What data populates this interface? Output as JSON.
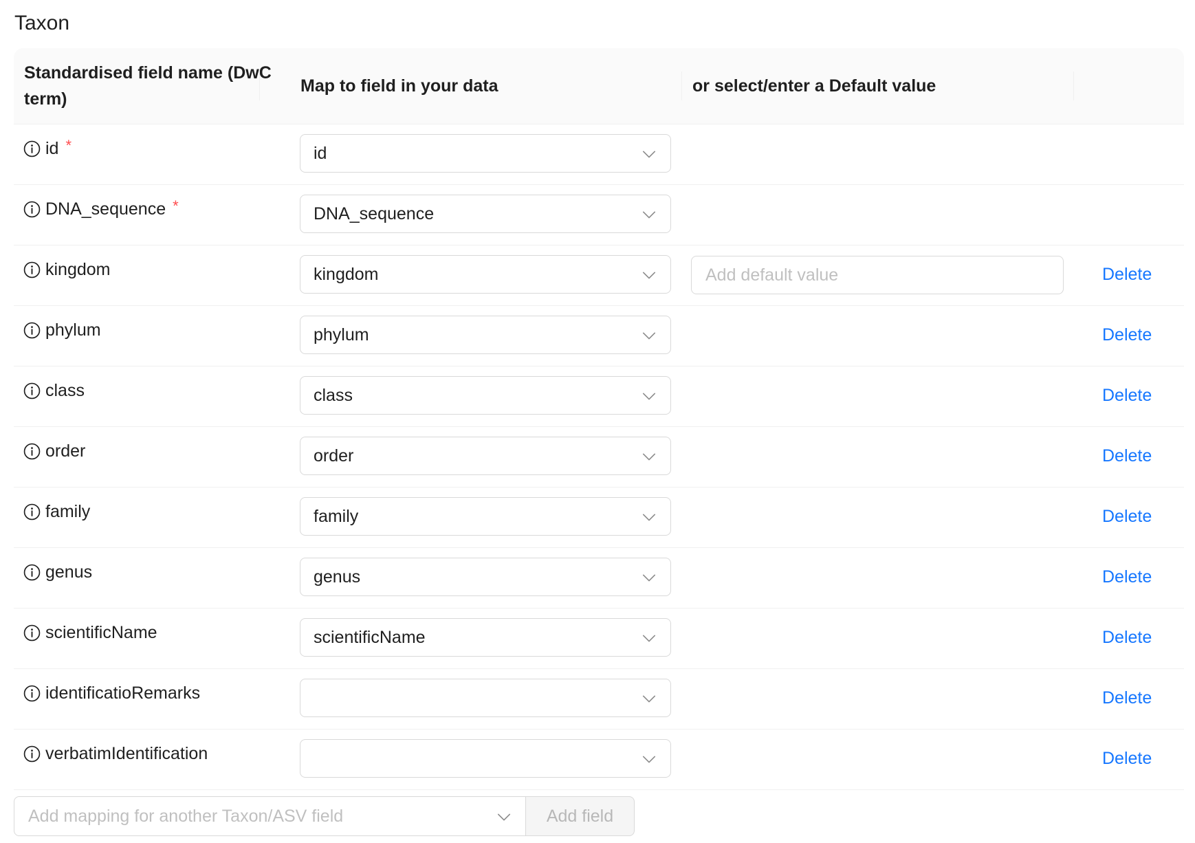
{
  "section_title": "Taxon",
  "table": {
    "headers": {
      "field_name": "Standardised field name (DwC term)",
      "map_to": "Map to field in your data",
      "default_value": "or select/enter a Default value"
    },
    "rows": [
      {
        "name": "id",
        "required": true,
        "mapped_value": "id",
        "default_placeholder": null,
        "delete_label": null
      },
      {
        "name": "DNA_sequence",
        "required": true,
        "mapped_value": "DNA_sequence",
        "default_placeholder": null,
        "delete_label": null
      },
      {
        "name": "kingdom",
        "required": false,
        "mapped_value": "kingdom",
        "default_placeholder": "Add default value",
        "delete_label": "Delete"
      },
      {
        "name": "phylum",
        "required": false,
        "mapped_value": "phylum",
        "default_placeholder": null,
        "delete_label": "Delete"
      },
      {
        "name": "class",
        "required": false,
        "mapped_value": "class",
        "default_placeholder": null,
        "delete_label": "Delete"
      },
      {
        "name": "order",
        "required": false,
        "mapped_value": "order",
        "default_placeholder": null,
        "delete_label": "Delete"
      },
      {
        "name": "family",
        "required": false,
        "mapped_value": "family",
        "default_placeholder": null,
        "delete_label": "Delete"
      },
      {
        "name": "genus",
        "required": false,
        "mapped_value": "genus",
        "default_placeholder": null,
        "delete_label": "Delete"
      },
      {
        "name": "scientificName",
        "required": false,
        "mapped_value": "scientificName",
        "default_placeholder": null,
        "delete_label": "Delete"
      },
      {
        "name": "identificatioRemarks",
        "required": false,
        "mapped_value": "",
        "default_placeholder": null,
        "delete_label": "Delete"
      },
      {
        "name": "verbatimIdentification",
        "required": false,
        "mapped_value": "",
        "default_placeholder": null,
        "delete_label": "Delete"
      }
    ],
    "required_marker": "*"
  },
  "add_field": {
    "placeholder": "Add mapping for another Taxon/ASV field",
    "button_label": "Add field"
  },
  "icons": {
    "info": "info-circle-icon",
    "dropdown": "chevron-down-icon"
  },
  "colors": {
    "link": "#1677ff",
    "required": "#ff4d4f",
    "header_bg": "#fafafa",
    "border": "#d9d9d9"
  }
}
